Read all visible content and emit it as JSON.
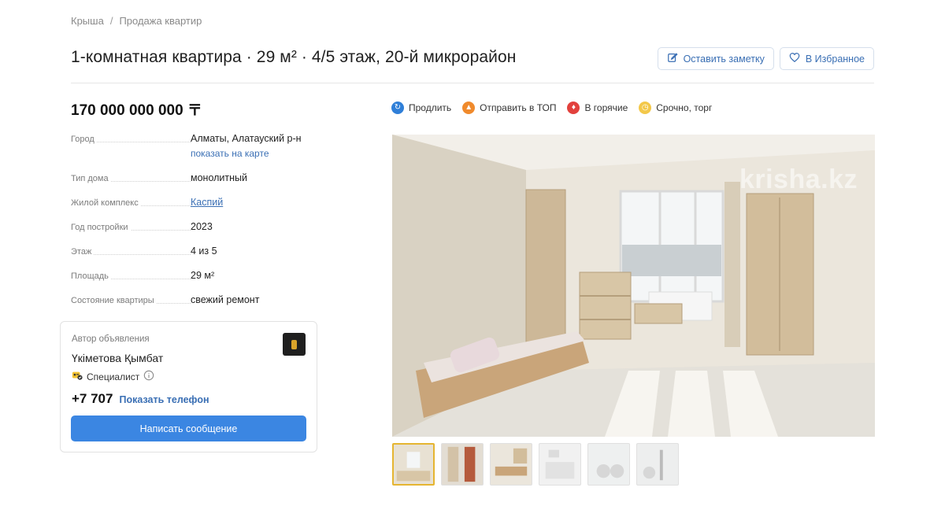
{
  "breadcrumb": {
    "items": [
      "Крыша",
      "Продажа квартир"
    ],
    "separator": "/"
  },
  "listing": {
    "title": "1-комнатная квартира · 29 м² · 4/5 этаж, 20-й микрорайон",
    "price": "170 000 000 000 〒"
  },
  "actions": {
    "note_label": "Оставить заметку",
    "favorite_label": "В Избранное"
  },
  "params": [
    {
      "key": "Город",
      "value": "Алматы, Алатауский р-н",
      "link": "показать на карте"
    },
    {
      "key": "Тип дома",
      "value": "монолитный"
    },
    {
      "key": "Жилой комплекс",
      "value": "Каспий"
    },
    {
      "key": "Год постройки",
      "value": "2023"
    },
    {
      "key": "Этаж",
      "value": "4 из 5"
    },
    {
      "key": "Площадь",
      "value": "29 м²"
    },
    {
      "key": "Состояние квартиры",
      "value": "свежий ремонт"
    }
  ],
  "author": {
    "label": "Автор объявления",
    "name": "Үкіметова Қымбат",
    "badge": "Специалист",
    "phone": "+7 707",
    "show_phone": "Показать телефон",
    "message_button": "Написать сообщение"
  },
  "promo": [
    {
      "label": "Продлить",
      "icon": "refresh-icon",
      "color": "#2f7fd8"
    },
    {
      "label": "Отправить в ТОП",
      "icon": "arrow-up-icon",
      "color": "#f08a2c"
    },
    {
      "label": "В горячие",
      "icon": "fire-icon",
      "color": "#e2413d"
    },
    {
      "label": "Срочно, торг",
      "icon": "clock-icon",
      "color": "#f3c84a"
    }
  ],
  "gallery": {
    "watermark": "krisha.kz",
    "thumbnail_count": 6,
    "active_index": 0
  },
  "colors": {
    "accent": "#3b86e2",
    "link": "#3a6fb4",
    "active_thumb": "#e5b531"
  }
}
